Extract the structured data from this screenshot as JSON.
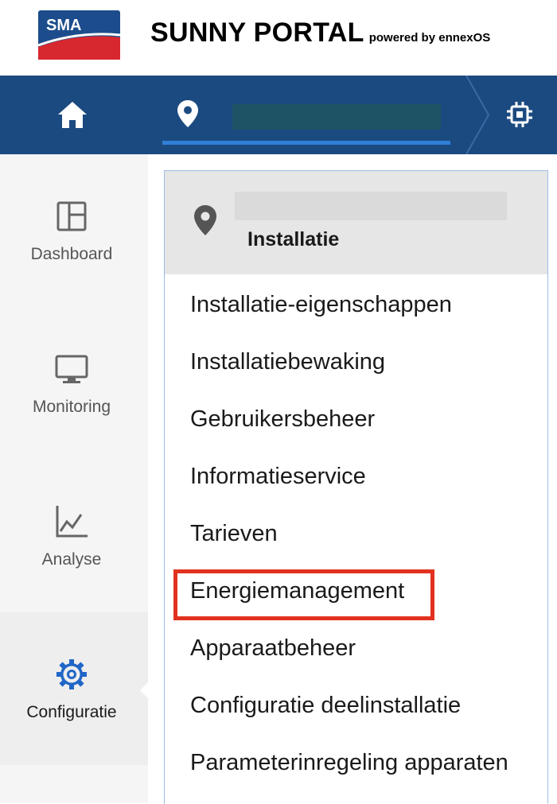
{
  "header": {
    "logo_text": "SMA",
    "brand_title": "SUNNY PORTAL",
    "brand_subtitle": "powered by ennexOS"
  },
  "topnav": {
    "home_icon": "home-icon",
    "plant_icon": "map-pin-icon",
    "plant_name_redacted": true,
    "device_icon": "chip-icon"
  },
  "sidebar": {
    "items": [
      {
        "label": "Dashboard",
        "icon": "dashboard-layout-icon",
        "active": false
      },
      {
        "label": "Monitoring",
        "icon": "monitor-icon",
        "active": false
      },
      {
        "label": "Analyse",
        "icon": "line-chart-icon",
        "active": false
      },
      {
        "label": "Configuratie",
        "icon": "gear-icon",
        "active": true
      }
    ]
  },
  "panel": {
    "title": "Installatie",
    "name_redacted": true,
    "items": [
      "Installatie-eigenschappen",
      "Installatiebewaking",
      "Gebruikersbeheer",
      "Informatieservice",
      "Tarieven",
      "Energiemanagement",
      "Apparaatbeheer",
      "Configuratie deelinstallatie",
      "Parameterinregeling apparaten"
    ],
    "highlighted_item": "Energiemanagement"
  },
  "colors": {
    "nav_blue": "#1b4a80",
    "tab_underline": "#2f7fd6",
    "highlight_red": "#e2321f",
    "active_icon": "#2166c7",
    "logo_blue": "#1c4c8b",
    "logo_red": "#d7282f"
  }
}
